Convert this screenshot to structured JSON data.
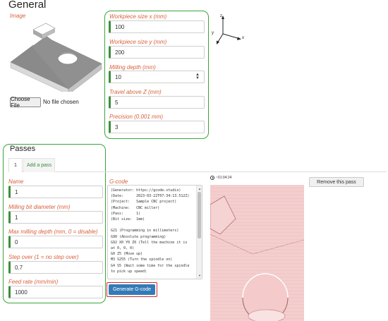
{
  "general": {
    "title": "General",
    "image_label": "Image",
    "file_button": "Choose File",
    "file_status": "No file chosen",
    "fields": [
      {
        "label": "Workpiece size x (mm)",
        "value": "100"
      },
      {
        "label": "Workpiece size y (mm)",
        "value": "200"
      },
      {
        "label": "Milling depth (mm)",
        "value": "10"
      },
      {
        "label": "Travel above Z (mm)",
        "value": "5"
      },
      {
        "label": "Precision (0.001 mm)",
        "value": "3"
      }
    ],
    "axes": {
      "z": "z",
      "y": "y",
      "x": "x"
    }
  },
  "passes": {
    "title": "Passes",
    "tabs": [
      {
        "label": "1"
      },
      {
        "label": "Add a pass"
      }
    ],
    "fields": [
      {
        "label": "Name",
        "value": "1"
      },
      {
        "label": "Milling bit diameter (mm)",
        "value": "1"
      },
      {
        "label": "Max milling depth (mm, 0 = disable)",
        "value": "0"
      },
      {
        "label": "Step over (1 = no step over)",
        "value": "0.7"
      },
      {
        "label": "Feed rate (mm/min)",
        "value": "1000"
      }
    ],
    "gcode_label": "G-code",
    "gcode_text": "(Generator: https://gcode.studio)\n(Date:      2023-03-22T07:34:13.512Z)\n(Project:   Sample CNC project)\n(Machine:   CNC miller)\n(Pass:      1)\n(Bit size:  1mm)\n\nG21 (Programming in millimeters)\nG90 (Absolute programming)\nG92 X0 Y0 Z0 (Tell the machine it is at 0, 0, 0)\nG0 Z5 (Move up)\nM3 S255 (Turn the spindle on)\nG4 S5 (Wait some time for the spindle to pick up speed)",
    "generate_button": "Generate G-code",
    "timer": "~01:04:24",
    "remove_button": "Remove this pass"
  },
  "colors": {
    "highlight_green": "#3aa43a",
    "highlight_red": "#cc2b2b",
    "label_orange": "#d9603b",
    "primary_blue": "#337ab7",
    "preview_pink": "#f4c9c9"
  }
}
